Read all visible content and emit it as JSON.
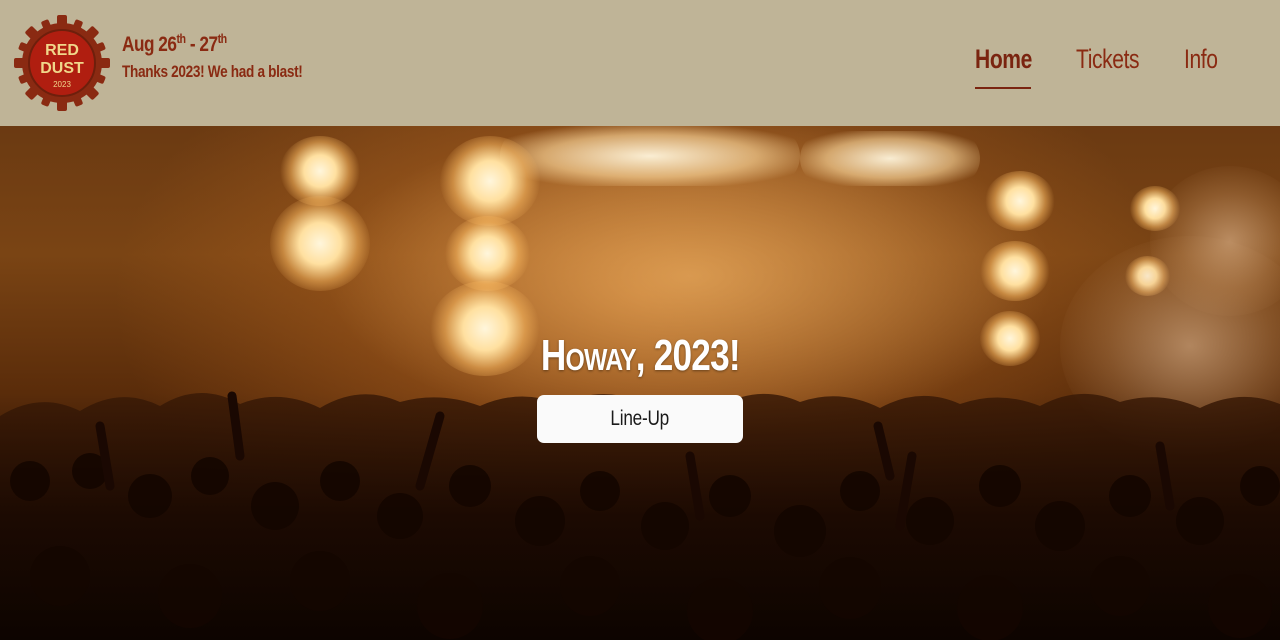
{
  "logo": {
    "line1": "RED",
    "line2": "DUST",
    "year": "2023",
    "colors": {
      "gear": "#8a2a12",
      "inner": "#b01e10",
      "text": "#f0d78a"
    }
  },
  "event": {
    "dates": {
      "start": "Aug 26",
      "start_suffix": "th",
      "separator": " - ",
      "end": "27",
      "end_suffix": "th"
    },
    "tagline": "Thanks 2023! We had a blast!"
  },
  "nav": {
    "items": [
      {
        "label": "Home",
        "active": true
      },
      {
        "label": "Tickets",
        "active": false
      },
      {
        "label": "Info",
        "active": false
      }
    ]
  },
  "hero": {
    "title": "Howay, 2023!",
    "button_label": "Line-Up"
  },
  "colors": {
    "header_bg": "#bfb497",
    "brand": "#8a2a12",
    "button_bg": "#fafafa"
  },
  "icons": [
    "gear-logo-icon"
  ]
}
